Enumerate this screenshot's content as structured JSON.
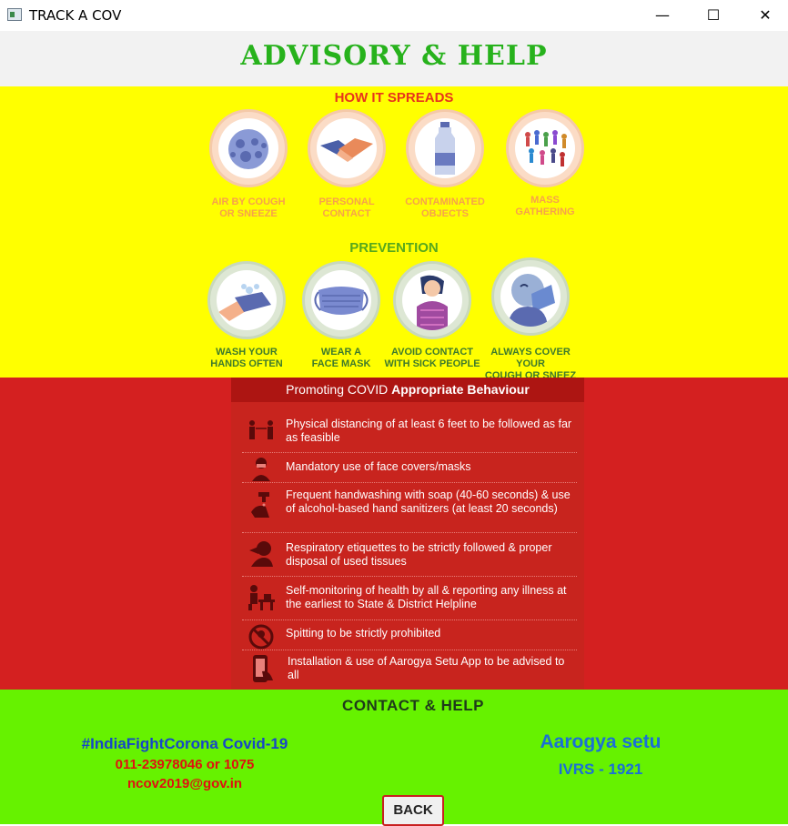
{
  "window": {
    "title": "TRACK A COV",
    "minimize_glyph": "—",
    "maximize_glyph": "☐",
    "close_glyph": "✕"
  },
  "header": {
    "title": "ADVISORY & HELP"
  },
  "how_it_spreads": {
    "title": "HOW IT SPREADS",
    "items": [
      {
        "label_line1": "AIR BY COUGH",
        "label_line2": "OR SNEEZE",
        "icon": "virus-icon"
      },
      {
        "label_line1": "PERSONAL",
        "label_line2": "CONTACT",
        "icon": "handshake-icon"
      },
      {
        "label_line1": "CONTAMINATED",
        "label_line2": "OBJECTS",
        "icon": "bottle-icon"
      },
      {
        "label_line1": "MASS",
        "label_line2": "GATHERING",
        "icon": "crowd-icon"
      }
    ]
  },
  "prevention": {
    "title": "PREVENTION",
    "items": [
      {
        "label_line1": "WASH YOUR",
        "label_line2": "HANDS OFTEN",
        "icon": "hand-wash-icon"
      },
      {
        "label_line1": "WEAR A",
        "label_line2": "FACE MASK",
        "icon": "face-mask-icon"
      },
      {
        "label_line1": "AVOID CONTACT",
        "label_line2": "WITH SICK PEOPLE",
        "icon": "sick-person-icon"
      },
      {
        "label_line1": "ALWAYS COVER YOUR",
        "label_line2": "COUGH OR SNEEZ",
        "icon": "cover-cough-icon"
      }
    ]
  },
  "behaviour": {
    "title_plain": "Promoting COVID ",
    "title_bold": "Appropriate Behaviour",
    "items": [
      {
        "text": "Physical distancing of at least 6 feet to be followed as far as feasible",
        "icon": "distancing-icon"
      },
      {
        "text": "Mandatory use of face covers/masks",
        "icon": "mask-person-icon"
      },
      {
        "text": "Frequent handwashing with soap (40-60 seconds) & use of alcohol-based hand sanitizers (at least 20 seconds)",
        "icon": "tap-icon"
      },
      {
        "text": "Respiratory etiquettes to be strictly followed & proper disposal of used tissues",
        "icon": "sneeze-icon"
      },
      {
        "text": "Self-monitoring of health by all & reporting any illness at the earliest to State & District Helpline",
        "icon": "self-monitor-icon"
      },
      {
        "text": "Spitting to be strictly prohibited",
        "icon": "no-spitting-icon"
      },
      {
        "text": "Installation & use of Aarogya Setu App to be advised to all",
        "icon": "phone-app-icon"
      }
    ]
  },
  "contact": {
    "title": "CONTACT & HELP",
    "hashtag": "#IndiaFightCorona Covid-19",
    "phone": "011-23978046 or 1075",
    "email": "ncov2019@gov.in",
    "app_name": "Aarogya setu",
    "ivrs": "IVRS - 1921",
    "back_label": "BACK"
  },
  "colors": {
    "header_title": "#27b21c",
    "yellow_band": "#ffff00",
    "red_band": "#d42020",
    "green_band": "#66f200",
    "spreads_title": "#e8341c",
    "prevention_title": "#58a81c"
  }
}
